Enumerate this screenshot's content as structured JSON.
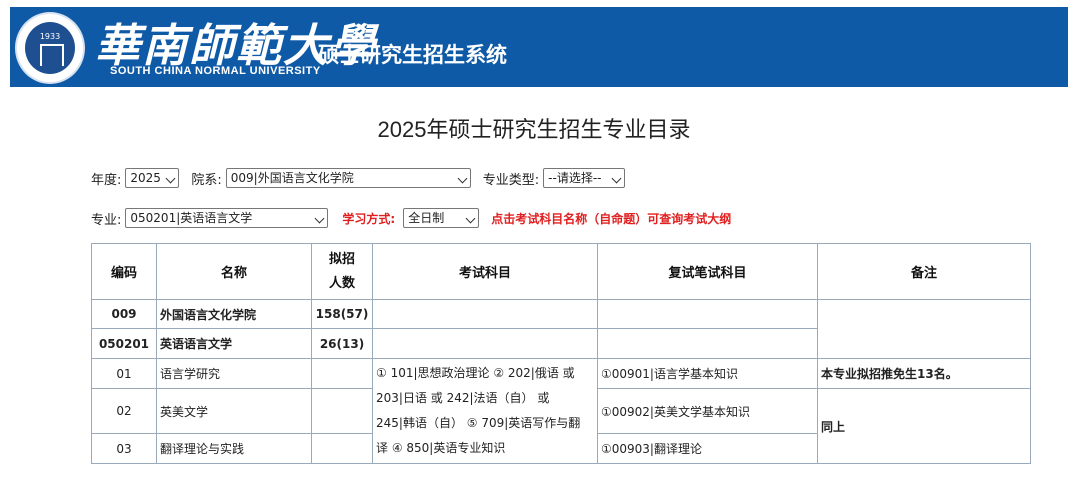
{
  "header": {
    "logo_year": "1933",
    "university_cn": "華南師範大學",
    "system_name": "硕士研究生招生系统",
    "university_en": "SOUTH CHINA NORMAL UNIVERSITY"
  },
  "page_title": "2025年硕士研究生招生专业目录",
  "filters": {
    "year_label": "年度:",
    "year_value": "2025",
    "dept_label": "院系:",
    "dept_value": "009|外国语言文化学院",
    "type_label": "专业类型:",
    "type_value": "--请选择--",
    "major_label": "专业:",
    "major_value": "050201|英语语言文学",
    "mode_label": "学习方式:",
    "mode_value": "全日制",
    "hint": "点击考试科目名称（自命题）可查询考试大纲"
  },
  "table": {
    "headers": {
      "code": "编码",
      "name": "名称",
      "quota_line1": "拟招",
      "quota_line2": "人数",
      "exam": "考试科目",
      "retest": "复试笔试科目",
      "remark": "备注"
    },
    "dept_row": {
      "code": "009",
      "name": "外国语言文化学院",
      "quota": "158(57)"
    },
    "major_row": {
      "code": "050201",
      "name": "英语语言文学",
      "quota": "26(13)"
    },
    "exam_lines": [
      "① 101|思想政治理论 ② 202|俄语 或",
      "203|日语 或 242|法语（自） 或",
      "245|韩语（自） ⑤ 709|英语写作与翻",
      "译 ④ 850|英语专业知识"
    ],
    "directions": [
      {
        "code": "01",
        "name": "语言学研究",
        "retest": "①00901|语言学基本知识"
      },
      {
        "code": "02",
        "name": "英美文学",
        "retest": "①00902|英美文学基本知识"
      },
      {
        "code": "03",
        "name": "翻译理论与实践",
        "retest": "①00903|翻译理论"
      }
    ],
    "remark_1": "本专业拟招推免生13名。",
    "remark_2": "同上"
  }
}
